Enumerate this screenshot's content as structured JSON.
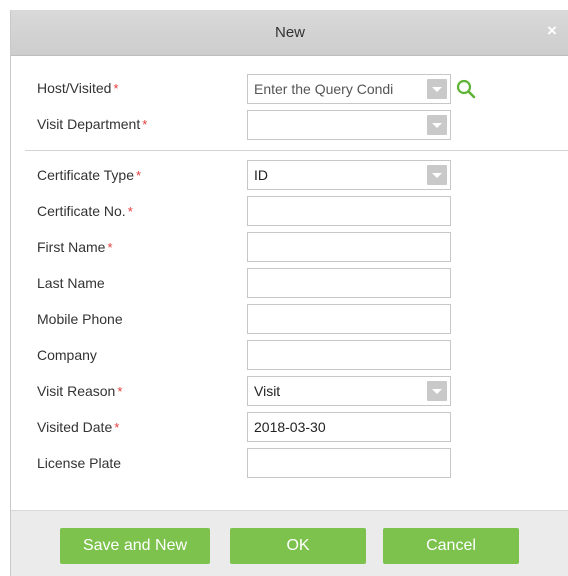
{
  "dialog": {
    "title": "New",
    "close_glyph": "×"
  },
  "fields": {
    "host_visited": {
      "label": "Host/Visited",
      "required": "*",
      "placeholder": "Enter the Query Condi",
      "value": ""
    },
    "visit_department": {
      "label": "Visit Department",
      "required": "*",
      "value": ""
    },
    "certificate_type": {
      "label": "Certificate Type",
      "required": "*",
      "value": "ID"
    },
    "certificate_no": {
      "label": "Certificate No.",
      "required": "*",
      "value": ""
    },
    "first_name": {
      "label": "First Name",
      "required": "*",
      "value": ""
    },
    "last_name": {
      "label": "Last Name",
      "value": ""
    },
    "mobile_phone": {
      "label": "Mobile Phone",
      "value": ""
    },
    "company": {
      "label": "Company",
      "value": ""
    },
    "visit_reason": {
      "label": "Visit Reason",
      "required": "*",
      "value": "Visit"
    },
    "visited_date": {
      "label": "Visited Date",
      "required": "*",
      "value": "2018-03-30"
    },
    "license_plate": {
      "label": "License Plate",
      "value": ""
    }
  },
  "buttons": {
    "save_and_new": "Save and New",
    "ok": "OK",
    "cancel": "Cancel"
  },
  "icons": {
    "search": "search-icon",
    "dropdown": "chevron-down-icon",
    "close": "close-icon"
  },
  "colors": {
    "button_green": "#7cc24d",
    "required_red": "#e23b3b",
    "search_green": "#5fb336",
    "titlebar_gray": "#d3d3d3"
  }
}
